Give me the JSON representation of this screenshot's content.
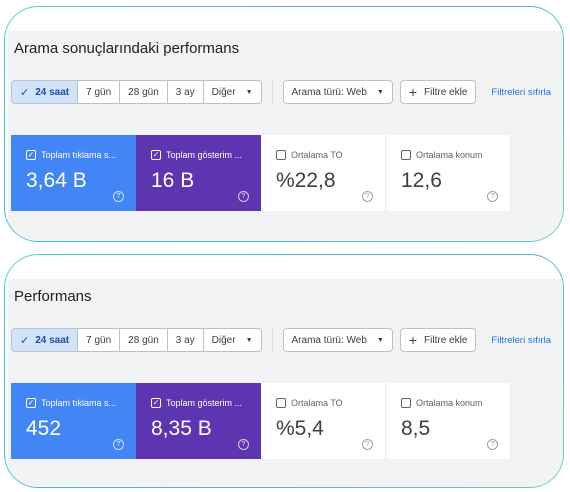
{
  "panels": [
    {
      "title": "Arama sonuçlarındaki performans",
      "date_ranges": [
        {
          "label": "24 saat",
          "active": true
        },
        {
          "label": "7 gün",
          "active": false
        },
        {
          "label": "28 gün",
          "active": false
        },
        {
          "label": "3 ay",
          "active": false
        },
        {
          "label": "Diğer",
          "active": false
        }
      ],
      "search_type_label": "Arama türü: Web",
      "add_filter_label": "Filtre ekle",
      "reset_filters_label": "Filtreleri sıfırla",
      "metrics": [
        {
          "label": "Toplam tıklama s...",
          "value": "3,64 B",
          "checked": true
        },
        {
          "label": "Toplam gösterim ...",
          "value": "16 B",
          "checked": true
        },
        {
          "label": "Ortalama TO",
          "value": "%22,8",
          "checked": false
        },
        {
          "label": "Ortalama konum",
          "value": "12,6",
          "checked": false
        }
      ]
    },
    {
      "title": "Performans",
      "date_ranges": [
        {
          "label": "24 saat",
          "active": true
        },
        {
          "label": "7 gün",
          "active": false
        },
        {
          "label": "28 gün",
          "active": false
        },
        {
          "label": "3 ay",
          "active": false
        },
        {
          "label": "Diğer",
          "active": false
        }
      ],
      "search_type_label": "Arama türü: Web",
      "add_filter_label": "Filtre ekle",
      "reset_filters_label": "Filtreleri sıfırla",
      "metrics": [
        {
          "label": "Toplam tıklama s...",
          "value": "452",
          "checked": true
        },
        {
          "label": "Toplam gösterim ...",
          "value": "8,35 B",
          "checked": true
        },
        {
          "label": "Ortalama TO",
          "value": "%5,4",
          "checked": false
        },
        {
          "label": "Ortalama konum",
          "value": "8,5",
          "checked": false
        }
      ]
    }
  ],
  "icons": {
    "check": "✓",
    "dropdown": "▼",
    "plus": "+",
    "help": "?"
  },
  "colors": {
    "clicks_card": "#4285f4",
    "impressions_card": "#5e35b1",
    "active_range": "#d2e3fc",
    "link": "#1a73e8",
    "frame_gradient": [
      "#4fd6c7",
      "#4bb0e8"
    ]
  }
}
